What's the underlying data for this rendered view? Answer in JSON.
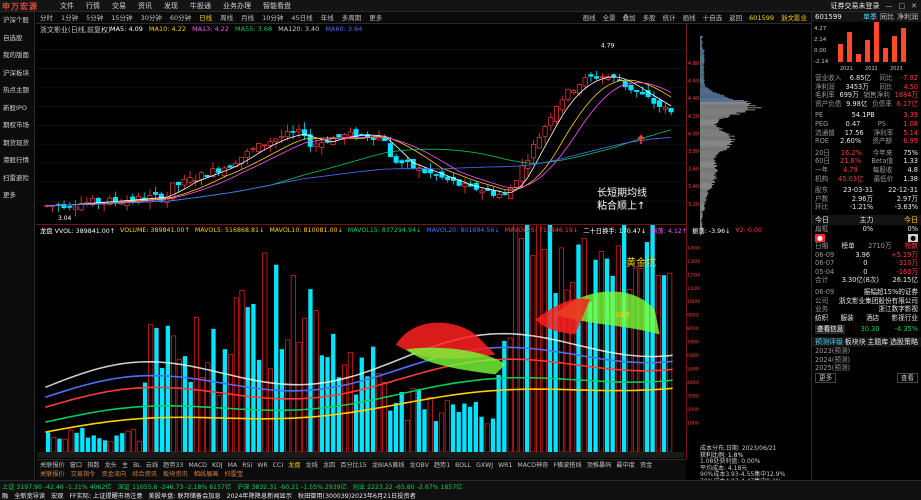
{
  "app": {
    "logo": "申万宏源",
    "menu": [
      "文件",
      "行情",
      "交易",
      "资讯",
      "发现",
      "牛股通",
      "业务办理",
      "智能看盘"
    ],
    "window_title": "证券交易未登录",
    "window_controls": [
      "—",
      "□",
      "✕"
    ]
  },
  "leftnav": [
    "沪深个股",
    "自选股",
    "我的版面",
    "沪深板块",
    "热点主题",
    "新股IPO",
    "期权市场",
    "期货现货",
    "港股行情",
    "扫雷避险",
    "更多"
  ],
  "periodbar": {
    "items": [
      "分时",
      "1分钟",
      "5分钟",
      "15分钟",
      "30分钟",
      "60分钟",
      "日线",
      "周线",
      "月线",
      "10分钟",
      "45日线",
      "年线",
      "多周期",
      "更多"
    ],
    "active": "日线",
    "tools": [
      "画线",
      "全景",
      "叠加",
      "多股",
      "统计",
      "画线",
      "十自选",
      "返回"
    ],
    "stock_code": "601599",
    "stock_name": "浙文影业"
  },
  "kchart": {
    "title": "浙文影业(日线,前复权)",
    "ma": [
      {
        "label": "MA5: 4.09",
        "color": "#ffffff"
      },
      {
        "label": "MA10: 4.22",
        "color": "#ffd000"
      },
      {
        "label": "MA13: 4.22",
        "color": "#ff55ff"
      },
      {
        "label": "MA55: 3.68",
        "color": "#00d05a"
      },
      {
        "label": "MA120: 3.40",
        "color": "#cfcfcf"
      },
      {
        "label": "MA60: 3.64",
        "color": "#4f6fff"
      }
    ],
    "price_levels": [
      "4.80",
      "4.60",
      "4.40",
      "4.20",
      "4.00",
      "3.80",
      "3.60",
      "3.40",
      "3.20"
    ],
    "high_mark": "4.79",
    "low_mark": "3.04",
    "annotation_line1": "长短期均线",
    "annotation_line2": "粘合顺上↑"
  },
  "volume": {
    "indicators": [
      {
        "label": "龙盘 VVOL: 389841.00↑",
        "color": "#ffffff"
      },
      {
        "label": "VOLUME: 389841.00↑",
        "color": "#ffd000"
      },
      {
        "label": "MAVOL5: 516868.81↓",
        "color": "#ffd000"
      },
      {
        "label": "MAVOL10: 810081.00↓",
        "color": "#ffd000"
      },
      {
        "label": "MAVOL15: 837294.94↓",
        "color": "#00d05a"
      },
      {
        "label": "MAVOL20: 801694.56↓",
        "color": "#4f6fff"
      },
      {
        "label": "MAVOL25: 718846.19↓",
        "color": "#ff3b3b"
      },
      {
        "label": "二十日换手: 170.47↓",
        "color": "#ffffff"
      },
      {
        "label": "振荡: 4.12↑",
        "color": "#ff55ff"
      },
      {
        "label": "振荡: -3.96↓",
        "color": "#ffffff"
      },
      {
        "label": "V2: 0.00",
        "color": "#ff3b3b"
      }
    ],
    "scale": [
      "14000",
      "13000",
      "12000",
      "11000",
      "10000",
      "9000",
      "8000",
      "7000",
      "6000",
      "5000",
      "4000",
      "3000",
      "2000",
      "1000"
    ],
    "annotation": "黄金坑",
    "tag": "买能量"
  },
  "chip": {
    "info": [
      "成本分布,日期: 2023/06/21",
      "获利比例:           1.8%",
      "1.08处获利盘: 0.00%",
      "平均成本: 4.18元",
      "90%成本3.93-4.55集中12.9%",
      "70%成本4.03-4.47集中9.2%"
    ]
  },
  "rightpanel": {
    "code": "601599",
    "name": "浙文影业",
    "tabs": [
      "单季",
      "同比",
      "净利润"
    ],
    "mini_chart_labels": [
      "4.27",
      "2.14",
      "0.00",
      "-2.14"
    ],
    "mini_years": [
      "2021",
      "2022",
      "2023"
    ],
    "stats": [
      [
        "营业收入",
        "6.85亿",
        "同比",
        "-7.92"
      ],
      [
        "净利润",
        "3453万",
        "同比",
        "4.50"
      ],
      [
        "毛利率",
        "699万",
        "销售净利",
        "1884万"
      ],
      [
        "资产负债",
        "9.98亿",
        "负债率",
        "6.17亿"
      ]
    ],
    "valuation": [
      [
        "PE",
        "54.1PB",
        "",
        "3.39"
      ],
      [
        "PEG",
        "0.47",
        "PS",
        "1.08"
      ],
      [
        "流通值",
        "17.56",
        "净利率",
        "5.14"
      ],
      [
        "ROE",
        "2.60%",
        "资产额",
        "6.99"
      ]
    ],
    "period": [
      [
        "20日",
        "16.2%",
        "今年来",
        "75%"
      ],
      [
        "60日",
        "21.6%",
        "Beta值",
        "1.33"
      ],
      [
        "一年",
        "4.79",
        "每股收",
        "4.8"
      ],
      [
        "机构",
        "45.03亿",
        "最低价",
        "1.38"
      ]
    ],
    "dividend": [
      [
        "股东",
        "23-03-31",
        "",
        "22-12-31"
      ],
      [
        "户数",
        "2.96万",
        "",
        "2.97万"
      ],
      [
        "环比",
        "-1.21%",
        "",
        "-3.63%"
      ]
    ],
    "chip_head": [
      "股东",
      "今日",
      "主力",
      "资金"
    ],
    "funds_tabs": [
      "今日",
      "主力",
      "今日"
    ],
    "funds": [
      [
        "扁框",
        "0%",
        "",
        "0%"
      ]
    ],
    "board": [
      [
        "日期",
        "榜单",
        "2710万",
        "榜数"
      ],
      [
        "06-09",
        "3.96",
        "",
        "+5.19万"
      ],
      [
        "06-07",
        "0",
        "",
        "-310万"
      ],
      [
        "05-04",
        "0",
        "",
        "-160万"
      ]
    ],
    "summary": [
      [
        "合计",
        "3.30亿(8次)",
        "",
        "26.15亿"
      ]
    ],
    "news_head": "日期",
    "news": [
      [
        "06-09",
        "振幅超15%的证券"
      ],
      [
        "公司",
        "浙文影业集团股份有限公司"
      ],
      [
        "业务",
        "浙江数字影视"
      ]
    ],
    "concepts": [
      "纺织",
      "服装",
      "酒店",
      "影视行业"
    ],
    "rating": {
      "label": "查看信息",
      "value1": "30.30",
      "value2": "-4.35%",
      "percent": "1.38%"
    },
    "forecast_tabs": [
      "预测评级",
      "板块块",
      "主题库",
      "选股策略"
    ],
    "forecast": [
      [
        "2023(预测)",
        ""
      ],
      [
        "2024(预测)",
        ""
      ],
      [
        "2025(预测)",
        ""
      ]
    ],
    "buttons": [
      "更多",
      "查看"
    ]
  },
  "bottomtabs": {
    "items": [
      "关联报价",
      "窗口",
      "指数",
      "龙头",
      "主",
      "BL",
      "云线",
      "趋势33",
      "MACD",
      "KDJ",
      "MA",
      "RSI",
      "WR",
      "CCI",
      "龙盘",
      "龙线",
      "龙四",
      "百分比15",
      "龙BIAS黄线",
      "龙OBV",
      "趋势1",
      "BOLL",
      "GXWJ",
      "WR1",
      "MACD神奇",
      "F横波搭线",
      "顶推暴码",
      "最中度",
      "资金"
    ],
    "highlight": "龙盘",
    "sub": [
      "关联报价",
      "交易指令",
      "资金流向",
      "综合资讯",
      "板块资讯",
      "相线展画",
      "扫雷宝"
    ]
  },
  "status": {
    "line1": [
      "上证 3197.90 -42.46 -1.31% 4062亿",
      "深证 11055.6 -246.73 -2.18% 6157亿",
      "沪深 3832.31 -60.21 -1.55% 2939亿",
      "创业 2223.22 -65.80 -2.87% 1857亿"
    ],
    "line2": [
      "融",
      "全新宽导读",
      "宏观",
      "FF实际: 上证提醒市场注意",
      "美股早盘: 联邦储备会加息",
      "2024年降降息新闻显示",
      "秋田御用(300039)2023年6月21日投资者"
    ]
  },
  "colors": {
    "up": "#ff3b3b",
    "down": "#00e5ff",
    "bg": "#000000",
    "ma5": "#ffffff",
    "ma10": "#ffd000",
    "ma13": "#ff55ff",
    "ma55": "#00d05a",
    "ma60": "#4f6fff"
  }
}
